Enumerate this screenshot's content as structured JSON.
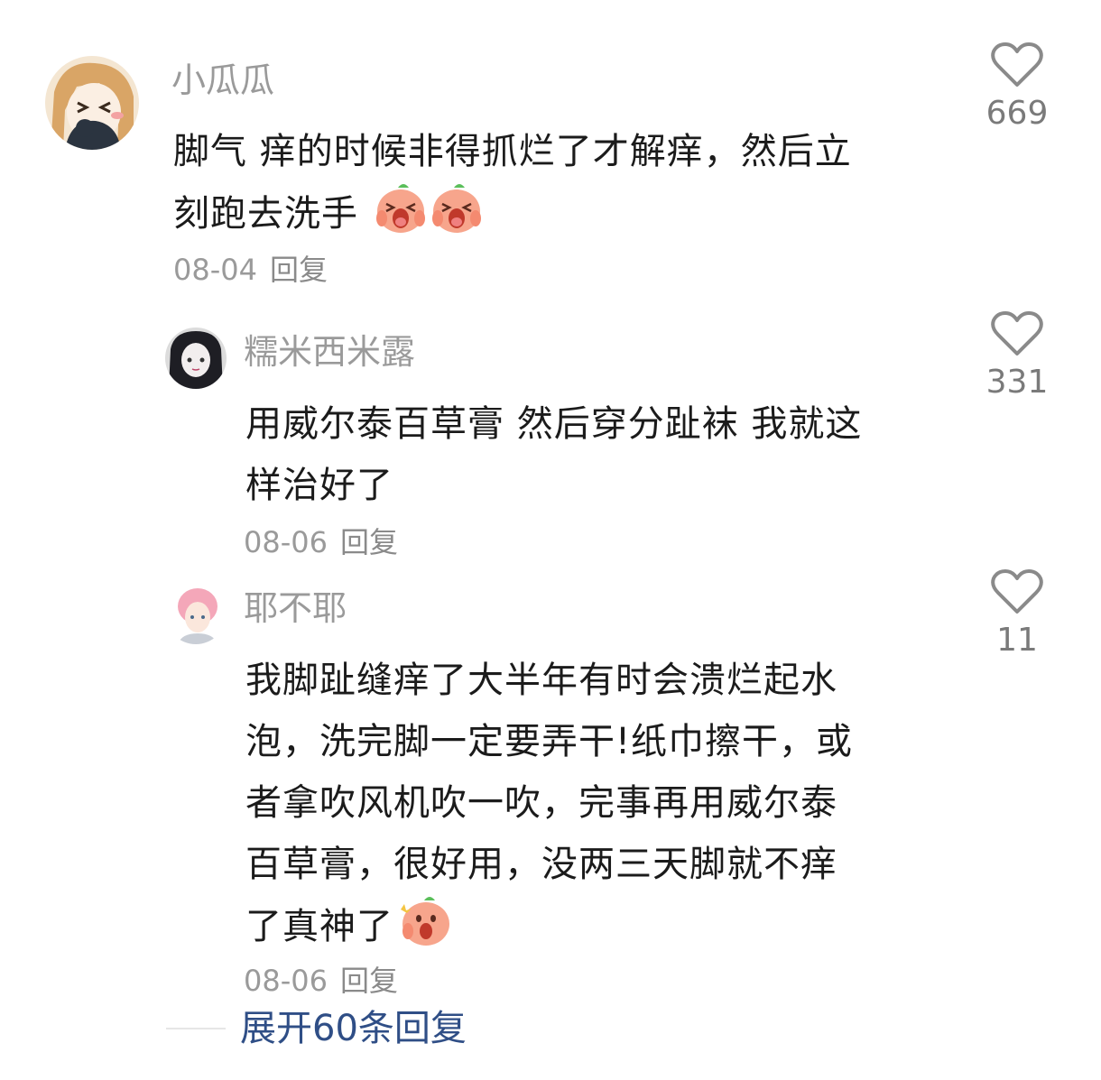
{
  "comments": [
    {
      "username": "小瓜瓜",
      "text_line1": "脚气 痒的时候非得抓烂了才解痒，然后立",
      "text_line2": "刻跑去洗手",
      "emojis": [
        "crying-emoji",
        "crying-emoji"
      ],
      "date": "08-04",
      "reply_label": "回复",
      "likes": "669"
    },
    {
      "username": "糯米西米露",
      "text_line1": "用威尔泰百草膏 然后穿分趾袜 我就这",
      "text_line2": "样治好了",
      "date": "08-06",
      "reply_label": "回复",
      "likes": "331"
    },
    {
      "username": "耶不耶",
      "text_line1": "我脚趾缝痒了大半年有时会溃烂起水",
      "text_line2": "泡，洗完脚一定要弄干!纸巾擦干，或",
      "text_line3": "者拿吹风机吹一吹，完事再用威尔泰",
      "text_line4": "百草膏，很好用，没两三天脚就不痒",
      "text_line5": "了真神了",
      "emojis": [
        "amazed-emoji"
      ],
      "date": "08-06",
      "reply_label": "回复",
      "likes": "11"
    }
  ],
  "expand_replies": "展开60条回复",
  "colors": {
    "username": "#9a9a9a",
    "content": "#1b1b1b",
    "link": "#2f4e86",
    "heart_outline": "#8a8a8a"
  }
}
